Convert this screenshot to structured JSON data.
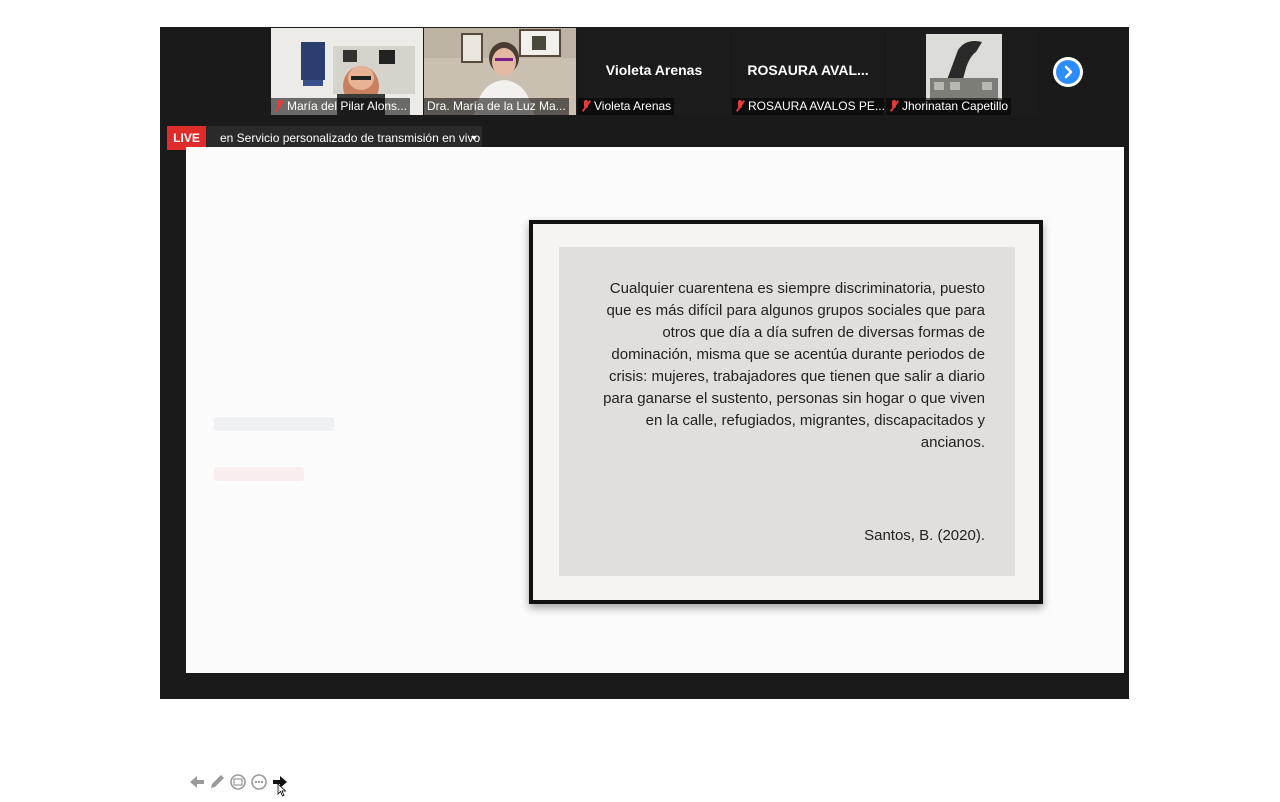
{
  "participants": [
    {
      "id": "p1",
      "label": "María del Pilar Alons...",
      "muted": true,
      "has_video": true
    },
    {
      "id": "p2",
      "label": "Dra. María de la Luz Ma...",
      "muted": false,
      "has_video": true,
      "active": true
    },
    {
      "id": "p3",
      "name": "Violeta Arenas",
      "label": "Violeta Arenas",
      "muted": true,
      "has_video": false
    },
    {
      "id": "p4",
      "name": "ROSAURA AVAL...",
      "label": "ROSAURA AVALOS PE...",
      "muted": true,
      "has_video": false
    },
    {
      "id": "p5",
      "label": "Jhorinatan Capetillo",
      "muted": true,
      "has_video": true
    }
  ],
  "live": {
    "badge": "LIVE",
    "text": "en Servicio personalizado de transmisión en vivo"
  },
  "slide": {
    "quote": "Cualquier cuarentena es siempre discriminatoria, puesto que es más difícil para algunos grupos sociales que para otros que día a día sufren de diversas formas de dominación, misma que se acentúa durante periodos de crisis: mujeres, trabajadores que tienen que salir a diario para ganarse el sustento, personas sin hogar o que viven en la calle, refugiados, migrantes, discapacitados y ancianos.",
    "citation": "Santos, B. (2020)."
  },
  "colors": {
    "live": "#e02b2b",
    "active_speaker": "#7bbf2c",
    "next_button": "#2d8cff"
  },
  "icons": {
    "next": "chevron-right-icon",
    "muted": "mic-muted-icon",
    "toolbar": [
      "arrow-left-icon",
      "pen-icon",
      "zoom-icon",
      "more-icon",
      "arrow-right-icon"
    ]
  }
}
